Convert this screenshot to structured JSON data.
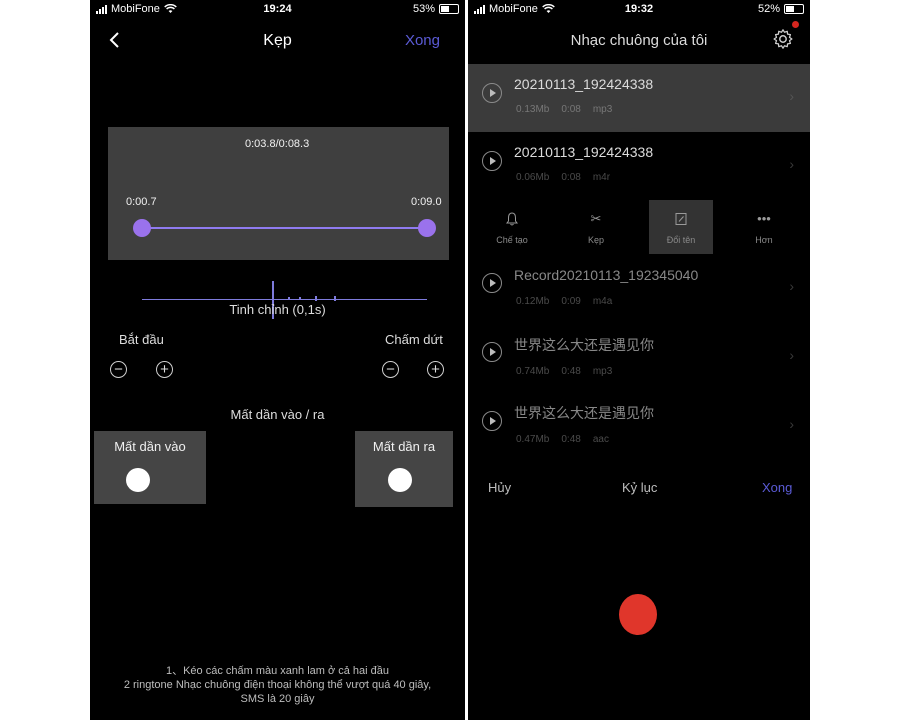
{
  "left": {
    "status": {
      "carrier": "MobiFone",
      "time": "19:24",
      "battery": "53%",
      "battery_level": 0.53
    },
    "nav": {
      "back_icon": "chevron-left-icon",
      "title": "Kẹp",
      "done": "Xong"
    },
    "waveform": {
      "position": "0:03.8/0:08.3",
      "start_time": "0:00.7",
      "end_time": "0:09.0"
    },
    "fine_tune_label": "Tinh chỉnh (0,1s)",
    "start_label": "Bắt đầu",
    "end_label": "Chấm dứt",
    "fade_section_label": "Mất dần vào / ra",
    "fade_in_label": "Mất dần vào",
    "fade_out_label": "Mất dần ra",
    "note": [
      "1、Kéo các chấm màu xanh lam ở cả hai đầu",
      "2 ringtone Nhạc chuông điện thoại không thể vượt quá 40 giây,",
      "SMS là 20 giây"
    ]
  },
  "right": {
    "status": {
      "carrier": "MobiFone",
      "time": "19:32",
      "battery": "52%",
      "battery_level": 0.52
    },
    "title": "Nhạc chuông của tôi",
    "settings_icon": "gear-icon",
    "items": [
      {
        "name": "20210113_192424338",
        "size": "0.13Mb",
        "duration": "0:08",
        "format": "mp3"
      },
      {
        "name": "20210113_192424338",
        "size": "0.06Mb",
        "duration": "0:08",
        "format": "m4r"
      },
      {
        "name": "Record20210113_192345040",
        "size": "0.12Mb",
        "duration": "0:09",
        "format": "m4a"
      },
      {
        "name": "世界这么大还是遇见你",
        "size": "0.74Mb",
        "duration": "0:48",
        "format": "mp3"
      },
      {
        "name": "世界这么大还是遇见你",
        "size": "0.47Mb",
        "duration": "0:48",
        "format": "aac"
      }
    ],
    "actions": [
      {
        "label": "Chế tạo",
        "icon": "bell-icon"
      },
      {
        "label": "Kẹp",
        "icon": "scissors-icon"
      },
      {
        "label": "Đổi tên",
        "icon": "edit-icon"
      },
      {
        "label": "Hơn",
        "icon": "more-icon"
      }
    ],
    "footer": {
      "cancel": "Hủy",
      "record": "Kỷ lục",
      "done": "Xong"
    },
    "colors": {
      "accent": "#5b5bd6",
      "record": "#e0362b"
    }
  }
}
